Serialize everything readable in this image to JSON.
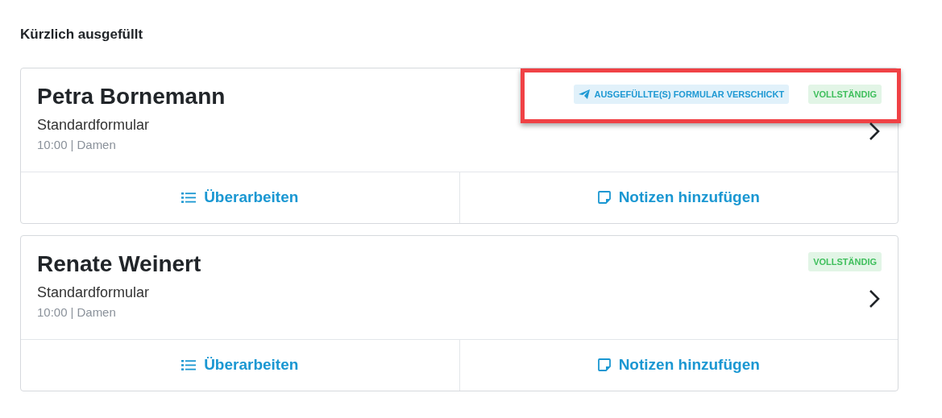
{
  "section_title": "Kürzlich ausgefüllt",
  "cards": [
    {
      "name": "Petra Bornemann",
      "form": "Standardformular",
      "time": "10:00",
      "separator": "|",
      "group": "Damen",
      "highlighted": true,
      "badges": [
        {
          "kind": "sent",
          "label": "AUSGEFÜLLTE(S) FORMULAR VERSCHICKT"
        },
        {
          "kind": "complete",
          "label": "VOLLSTÄNDIG"
        }
      ],
      "actions": [
        {
          "kind": "edit",
          "label": "Überarbeiten"
        },
        {
          "kind": "notes",
          "label": "Notizen hinzufügen"
        }
      ]
    },
    {
      "name": "Renate Weinert",
      "form": "Standardformular",
      "time": "10:00",
      "separator": "|",
      "group": "Damen",
      "highlighted": false,
      "badges": [
        {
          "kind": "complete",
          "label": "VOLLSTÄNDIG"
        }
      ],
      "actions": [
        {
          "kind": "edit",
          "label": "Überarbeiten"
        },
        {
          "kind": "notes",
          "label": "Notizen hinzufügen"
        }
      ]
    }
  ]
}
